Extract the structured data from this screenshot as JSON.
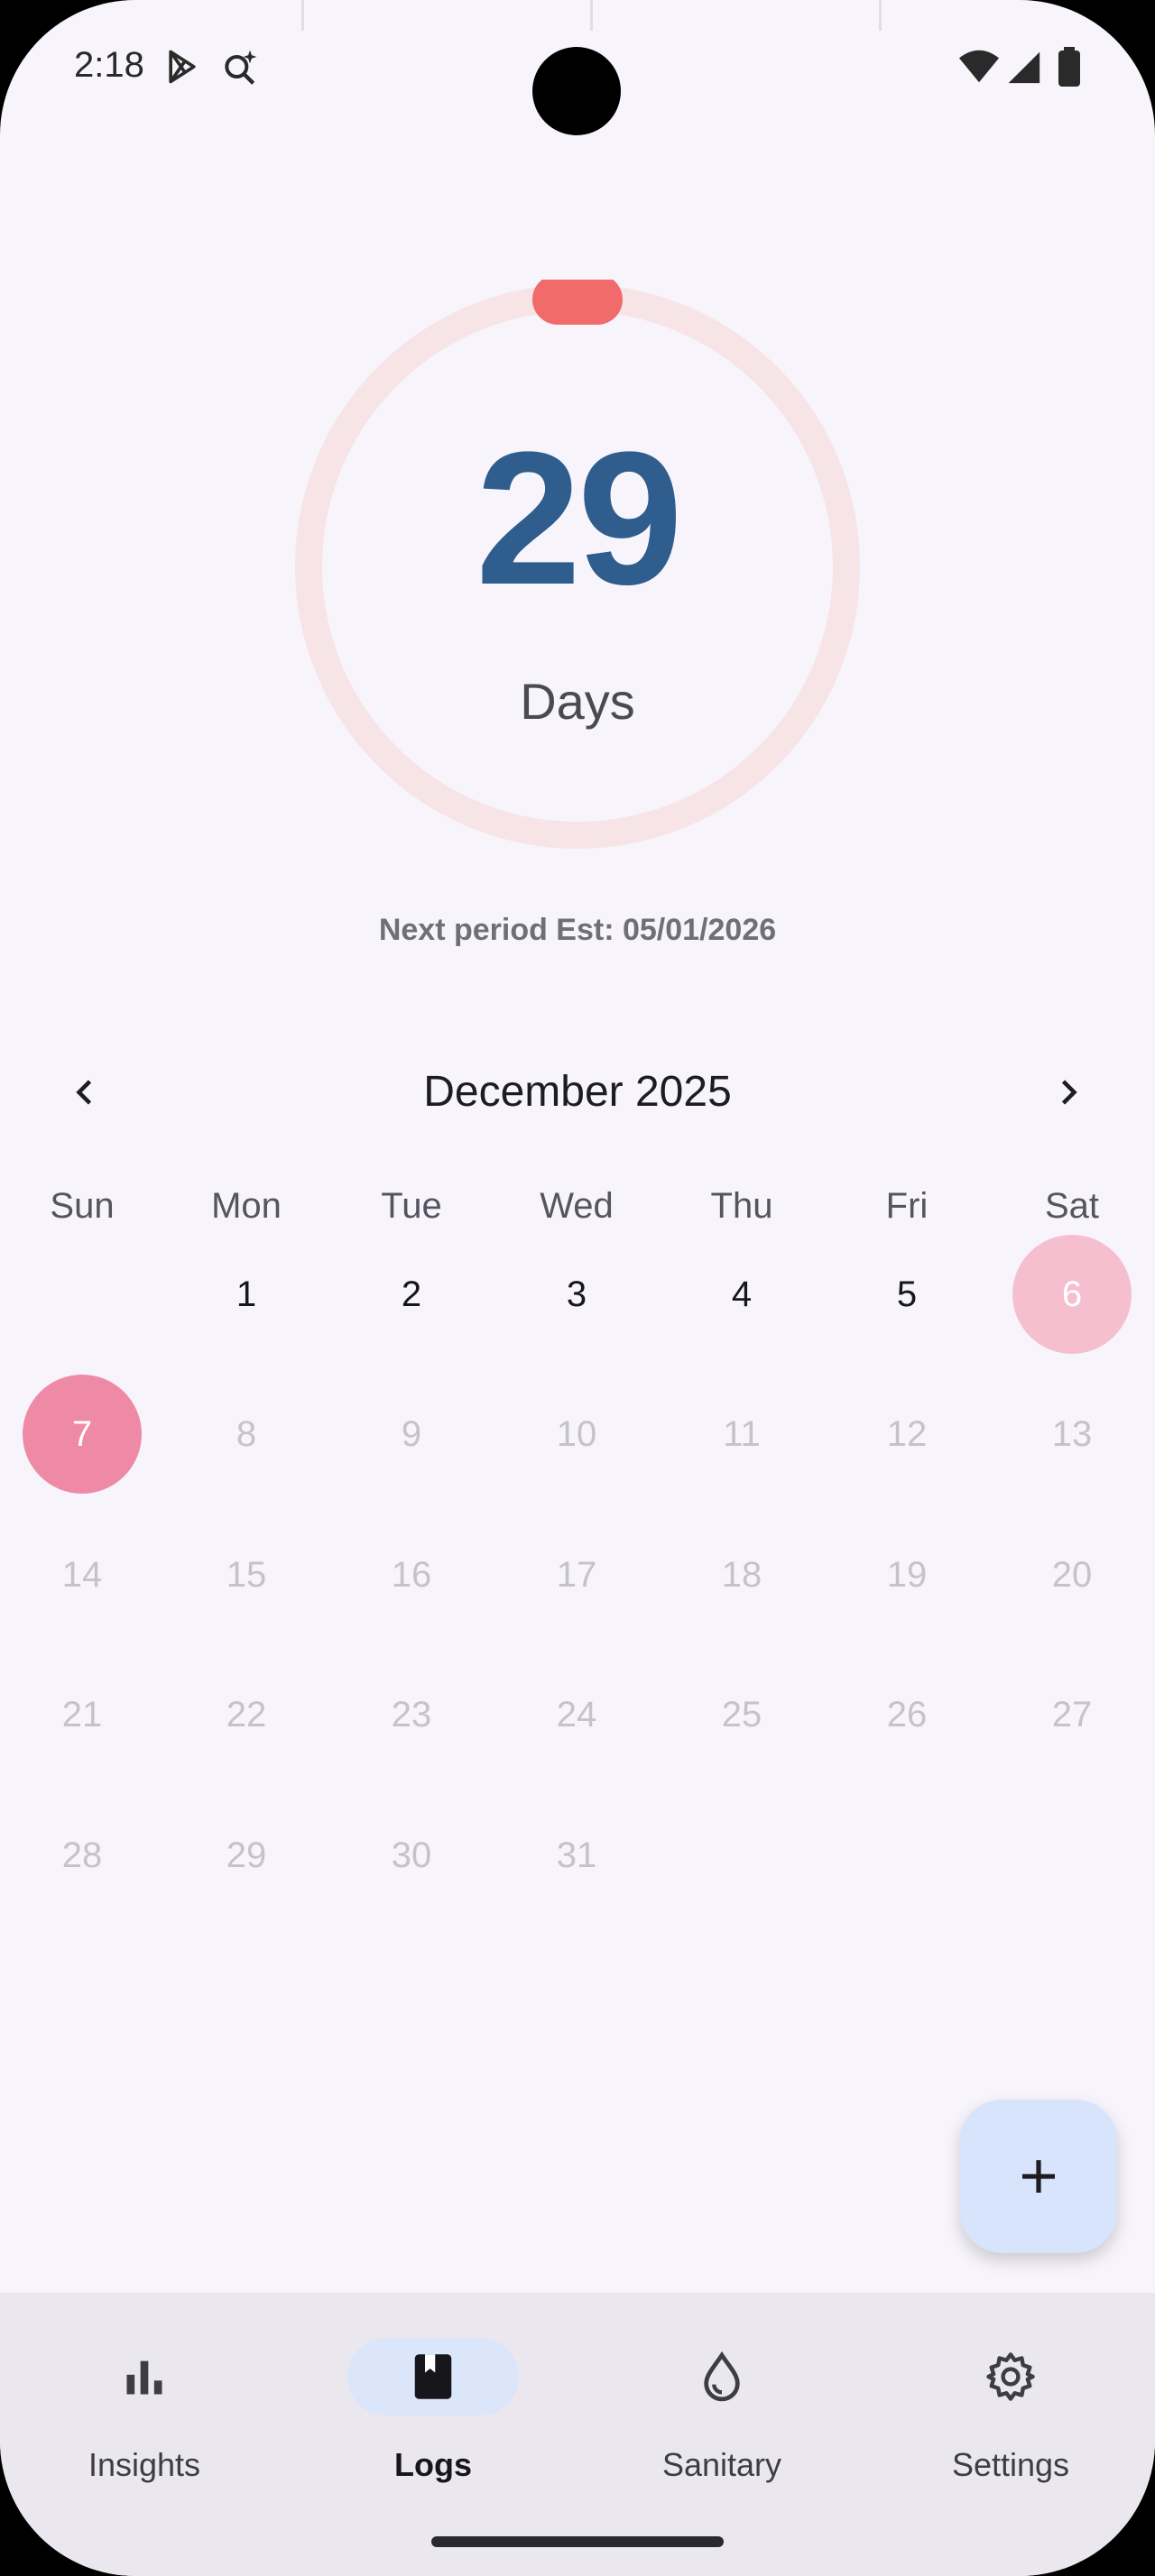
{
  "status_bar": {
    "time": "2:18"
  },
  "cycle": {
    "days": "29",
    "days_label": "Days",
    "next_period": "Next period Est: 05/01/2026"
  },
  "calendar": {
    "month": "December 2025",
    "weekdays": [
      "Sun",
      "Mon",
      "Tue",
      "Wed",
      "Thu",
      "Fri",
      "Sat"
    ],
    "rows": [
      [
        "",
        "1",
        "2",
        "3",
        "4",
        "5",
        "6"
      ],
      [
        "7",
        "8",
        "9",
        "10",
        "11",
        "12",
        "13"
      ],
      [
        "14",
        "15",
        "16",
        "17",
        "18",
        "19",
        "20"
      ],
      [
        "21",
        "22",
        "23",
        "24",
        "25",
        "26",
        "27"
      ],
      [
        "28",
        "29",
        "30",
        "31",
        "",
        "",
        ""
      ]
    ]
  },
  "fab": {
    "label": "+"
  },
  "bottom_nav": {
    "items": [
      {
        "label": "Insights",
        "icon": "bar-chart-icon"
      },
      {
        "label": "Logs",
        "icon": "book-icon"
      },
      {
        "label": "Sanitary",
        "icon": "drop-icon"
      },
      {
        "label": "Settings",
        "icon": "gear-icon"
      }
    ],
    "selected": "Logs"
  },
  "colors": {
    "accent_number": "#2f5d8d",
    "ring_indicator": "#f26b6b",
    "period_day": "#ef8aa6",
    "predicted_day": "#f5bfd0",
    "fab_background": "#d8e4fb",
    "nav_selected_pill": "#dbe6fb"
  }
}
